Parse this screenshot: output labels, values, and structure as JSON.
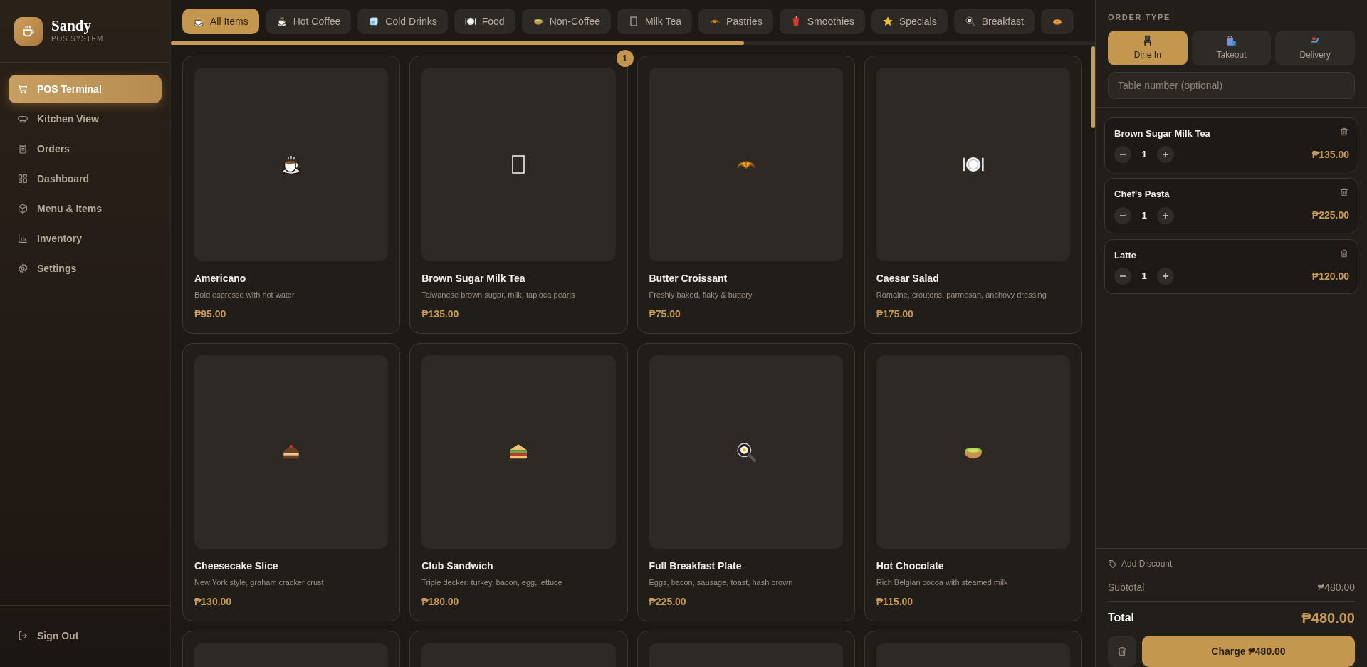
{
  "brand": {
    "name": "Sandy",
    "subtitle": "POS SYSTEM"
  },
  "sidebar": {
    "items": [
      {
        "label": "POS Terminal",
        "selected": true
      },
      {
        "label": "Kitchen View",
        "selected": false
      },
      {
        "label": "Orders",
        "selected": false
      },
      {
        "label": "Dashboard",
        "selected": false
      },
      {
        "label": "Menu & Items",
        "selected": false
      },
      {
        "label": "Inventory",
        "selected": false
      },
      {
        "label": "Settings",
        "selected": false
      }
    ],
    "footer": {
      "label": "Sign Out"
    }
  },
  "categories": [
    {
      "label": "All Items",
      "selected": true
    },
    {
      "label": "Hot Coffee",
      "selected": false
    },
    {
      "label": "Cold Drinks",
      "selected": false
    },
    {
      "label": "Food",
      "selected": false
    },
    {
      "label": "Non-Coffee",
      "selected": false
    },
    {
      "label": "Milk Tea",
      "selected": false
    },
    {
      "label": "Pastries",
      "selected": false
    },
    {
      "label": "Smoothies",
      "selected": false
    },
    {
      "label": "Specials",
      "selected": false
    },
    {
      "label": "Breakfast",
      "selected": false
    },
    {
      "selected": false
    }
  ],
  "products": [
    {
      "kind": "full",
      "name": "Americano",
      "description": "Bold espresso with hot water",
      "price": "₱95.00"
    },
    {
      "kind": "full",
      "name": "Brown Sugar Milk Tea",
      "description": "Taiwanese brown sugar, milk, tapioca pearls",
      "price": "₱135.00",
      "in_cart": "1"
    },
    {
      "kind": "full",
      "name": "Butter Croissant",
      "description": "Freshly baked, flaky & buttery",
      "price": "₱75.00"
    },
    {
      "kind": "full",
      "name": "Caesar Salad",
      "description": "Romaine, croutons, parmesan, anchovy dressing",
      "price": "₱175.00"
    },
    {
      "kind": "full",
      "name": "Cheesecake Slice",
      "description": "New York style, graham cracker crust",
      "price": "₱130.00"
    },
    {
      "kind": "full",
      "name": "Club Sandwich",
      "description": "Triple decker: turkey, bacon, egg, lettuce",
      "price": "₱180.00"
    },
    {
      "kind": "full",
      "name": "Full Breakfast Plate",
      "description": "Eggs, bacon, sausage, toast, hash brown",
      "price": "₱225.00"
    },
    {
      "kind": "full",
      "name": "Hot Chocolate",
      "description": "Rich Belgian cocoa with steamed milk",
      "price": "₱115.00"
    },
    {
      "kind": "cut"
    },
    {
      "kind": "cut"
    },
    {
      "kind": "cut"
    },
    {
      "kind": "cut"
    }
  ],
  "order": {
    "heading": "ORDER TYPE",
    "types": [
      {
        "label": "Dine In",
        "selected": true
      },
      {
        "label": "Takeout",
        "selected": false
      },
      {
        "label": "Delivery",
        "selected": false
      }
    ],
    "table_field": {
      "placeholder": "Table number (optional)"
    },
    "items": [
      {
        "name": "Brown Sugar Milk Tea",
        "qty": "1",
        "price": "₱135.00"
      },
      {
        "name": "Chef's Pasta",
        "qty": "1",
        "price": "₱225.00"
      },
      {
        "name": "Latte",
        "qty": "1",
        "price": "₱120.00"
      }
    ],
    "discount": "Add Discount",
    "subtotal": {
      "label": "Subtotal",
      "value": "₱480.00"
    },
    "total": {
      "label": "Total",
      "value": "₱480.00"
    },
    "charge": "Charge ₱480.00"
  }
}
